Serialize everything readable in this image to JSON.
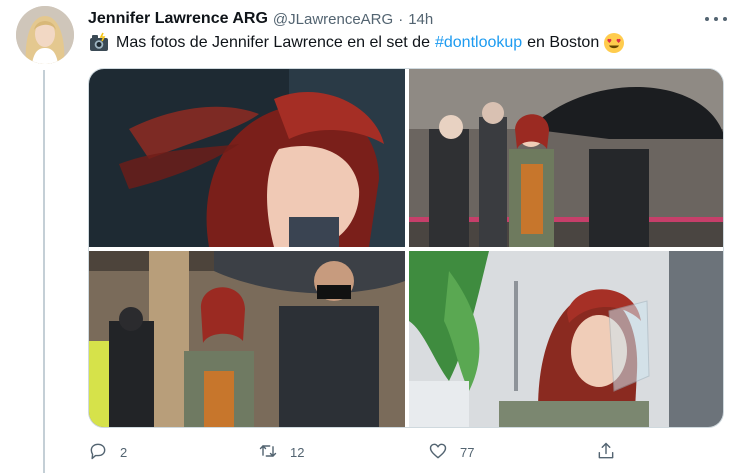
{
  "tweet": {
    "display_name": "Jennifer Lawrence ARG",
    "handle": "@JLawrenceARG",
    "separator": "·",
    "time": "14h",
    "text_before": "Mas fotos de Jennifer Lawrence en el set de",
    "hashtag": "#dontlookup",
    "text_after": "en Boston",
    "leading_emoji": "camera-with-flash",
    "trailing_emoji": "heart-eyes"
  },
  "media": {
    "images": [
      {
        "subject": "closeup red hair profile"
      },
      {
        "subject": "walking with umbrella crew"
      },
      {
        "subject": "walking with bodyguard"
      },
      {
        "subject": "face shield profile"
      }
    ]
  },
  "actions": {
    "reply_count": "2",
    "retweet_count": "12",
    "like_count": "77"
  },
  "colors": {
    "accent": "#1d9bf0",
    "secondary_text": "#536471",
    "hair_red": "#9b2a22"
  }
}
